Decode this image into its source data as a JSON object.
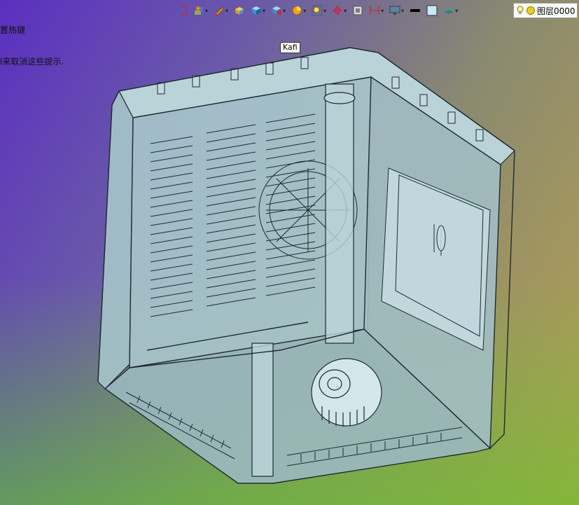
{
  "hint": {
    "line1": "置热键",
    "line2": "l来取消这些提示."
  },
  "toolbar": {
    "items": [
      {
        "name": "exit-sketch-icon",
        "dropdown": false
      },
      {
        "name": "view-orient-icon",
        "dropdown": true
      },
      {
        "name": "pencil-icon",
        "dropdown": true
      },
      {
        "name": "box-yellow-icon",
        "dropdown": false
      },
      {
        "name": "cube-shaded-icon",
        "dropdown": true
      },
      {
        "name": "cube-section-icon",
        "dropdown": true
      },
      {
        "name": "pie-icon",
        "dropdown": true
      },
      {
        "name": "zoom-area-icon",
        "dropdown": true
      },
      {
        "name": "crosshair-icon",
        "dropdown": true
      },
      {
        "name": "frame-icon",
        "dropdown": false
      },
      {
        "name": "dimension-icon",
        "dropdown": true
      },
      {
        "name": "monitor-icon",
        "dropdown": true
      },
      {
        "name": "line-color-icon",
        "dropdown": false
      },
      {
        "name": "fill-color-icon",
        "dropdown": false
      },
      {
        "name": "layers-icon",
        "dropdown": true
      }
    ]
  },
  "layer": {
    "label": "图层0000"
  },
  "tooltip": {
    "label": "Kafi"
  },
  "colors": {
    "model_fill": "#a9c6cc",
    "model_line": "#1e2a33",
    "background_top_left": "#5b2fc0",
    "background_bottom": "#5ac828"
  }
}
